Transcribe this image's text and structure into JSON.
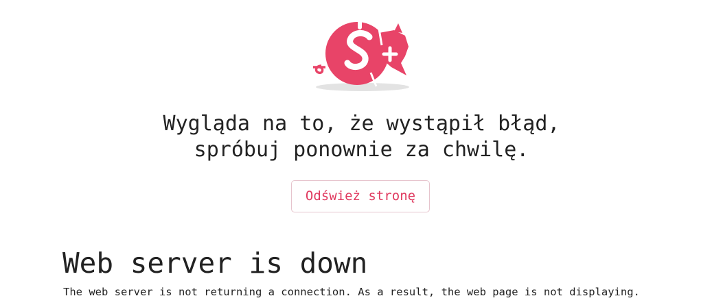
{
  "logo": {
    "icon": "pig-logo-icon",
    "color": "#e84468"
  },
  "message": {
    "line1": "Wygląda na to, że wystąpił błąd,",
    "line2": "spróbuj ponownie za chwilę."
  },
  "refresh_button": {
    "label": "Odśwież stronę",
    "color": "#e0395f"
  },
  "error": {
    "title": "Web server is down",
    "description": "The web server is not returning a connection. As a result, the web page is not displaying."
  }
}
